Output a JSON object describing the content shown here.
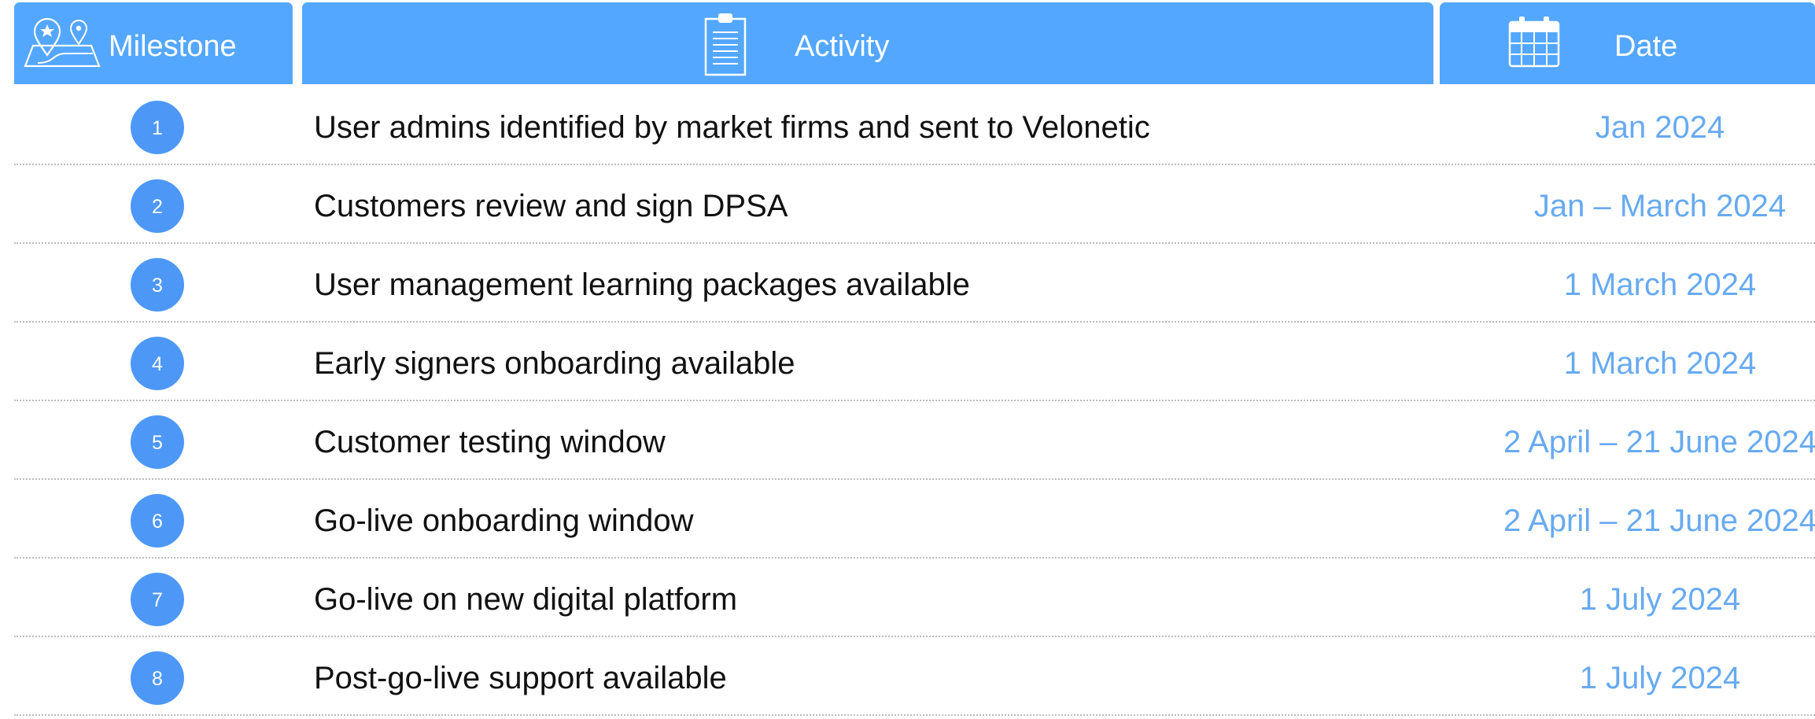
{
  "header": {
    "milestone_label": "Milestone",
    "activity_label": "Activity",
    "date_label": "Date",
    "milestone_icon": "map-pins-icon",
    "activity_icon": "clipboard-icon",
    "date_icon": "calendar-icon"
  },
  "colors": {
    "header_bg": "#54a7ff",
    "badge_bg": "#4d98f7",
    "date_text": "#67aaf1",
    "activity_text": "#111111",
    "row_divider": "#bdbdbd"
  },
  "rows": [
    {
      "number": "1",
      "activity": "User admins identified by market firms and sent to Velonetic",
      "date": "Jan 2024"
    },
    {
      "number": "2",
      "activity": "Customers review and sign DPSA",
      "date": "Jan – March 2024"
    },
    {
      "number": "3",
      "activity": "User management learning packages available",
      "date": "1 March 2024"
    },
    {
      "number": "4",
      "activity": "Early signers onboarding available",
      "date": "1 March 2024"
    },
    {
      "number": "5",
      "activity": "Customer testing window",
      "date": "2 April – 21 June 2024"
    },
    {
      "number": "6",
      "activity": "Go-live onboarding window",
      "date": "2 April – 21 June 2024"
    },
    {
      "number": "7",
      "activity": "Go-live on new digital platform",
      "date": "1 July 2024"
    },
    {
      "number": "8",
      "activity": "Post-go-live support available",
      "date": "1 July 2024"
    }
  ]
}
